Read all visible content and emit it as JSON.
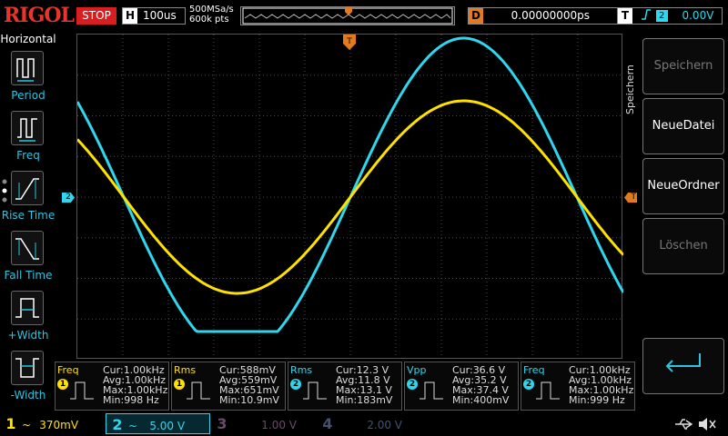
{
  "header": {
    "brand": "RIGOL",
    "run_state": "STOP",
    "timebase_letter": "H",
    "timebase": "100us",
    "sample_rate": "500MSa/s",
    "mem_depth": "600k pts",
    "trigger_delay_letter": "D",
    "trigger_delay": "0.00000000ps",
    "trigger_letter": "T",
    "trigger_channel": "2",
    "trigger_level": "0.00V"
  },
  "left_menu": {
    "title": "Horizontal",
    "items": [
      {
        "label": "Period",
        "icon": "period-icon"
      },
      {
        "label": "Freq",
        "icon": "frequency-icon"
      },
      {
        "label": "Rise Time",
        "icon": "rise-time-icon"
      },
      {
        "label": "Fall Time",
        "icon": "fall-time-icon"
      },
      {
        "label": "+Width",
        "icon": "positive-width-icon"
      },
      {
        "label": "-Width",
        "icon": "negative-width-icon"
      }
    ]
  },
  "right_menu": {
    "title": "Speichern",
    "buttons": [
      {
        "label": "Speichern",
        "state": "dim"
      },
      {
        "label": "NeueDatei",
        "state": "active"
      },
      {
        "label": "NeueOrdner",
        "state": "active"
      },
      {
        "label": "Löschen",
        "state": "dim"
      }
    ],
    "back_icon": "return-arrow-icon"
  },
  "markers": {
    "ch2_ground": "2",
    "trigger_level": "T"
  },
  "colors": {
    "ch1": "#ffe100",
    "ch2": "#2fd7ee",
    "trigger": "#e37b1e",
    "grid": "#4a4a4a"
  },
  "measurements": [
    {
      "name": "Freq",
      "channel": "1",
      "lines": [
        "Cur:1.00kHz",
        "Avg:1.00kHz",
        "Max:1.00kHz",
        "Min:998 Hz"
      ]
    },
    {
      "name": "Rms",
      "channel": "1",
      "lines": [
        "Cur:588mV",
        "Avg:559mV",
        "Max:651mV",
        "Min:10.9mV"
      ]
    },
    {
      "name": "Rms",
      "channel": "2",
      "lines": [
        "Cur:12.3 V",
        "Avg:11.8 V",
        "Max:13.1 V",
        "Min:183mV"
      ]
    },
    {
      "name": "Vpp",
      "channel": "2",
      "lines": [
        "Cur:36.6 V",
        "Avg:35.2 V",
        "Max:37.4 V",
        "Min:400mV"
      ]
    },
    {
      "name": "Freq",
      "channel": "2",
      "lines": [
        "Cur:1.00kHz",
        "Avg:1.00kHz",
        "Max:1.00kHz",
        "Min:999 Hz"
      ]
    }
  ],
  "channels": [
    {
      "num": "1",
      "coupling": "~",
      "scale": "370mV"
    },
    {
      "num": "2",
      "coupling": "~",
      "scale": "5.00 V"
    },
    {
      "num": "3",
      "coupling": "",
      "scale": "1.00 V"
    },
    {
      "num": "4",
      "coupling": "",
      "scale": "2.00 V"
    }
  ],
  "status_icons": [
    "usb-icon",
    "speaker-muted-icon"
  ]
}
